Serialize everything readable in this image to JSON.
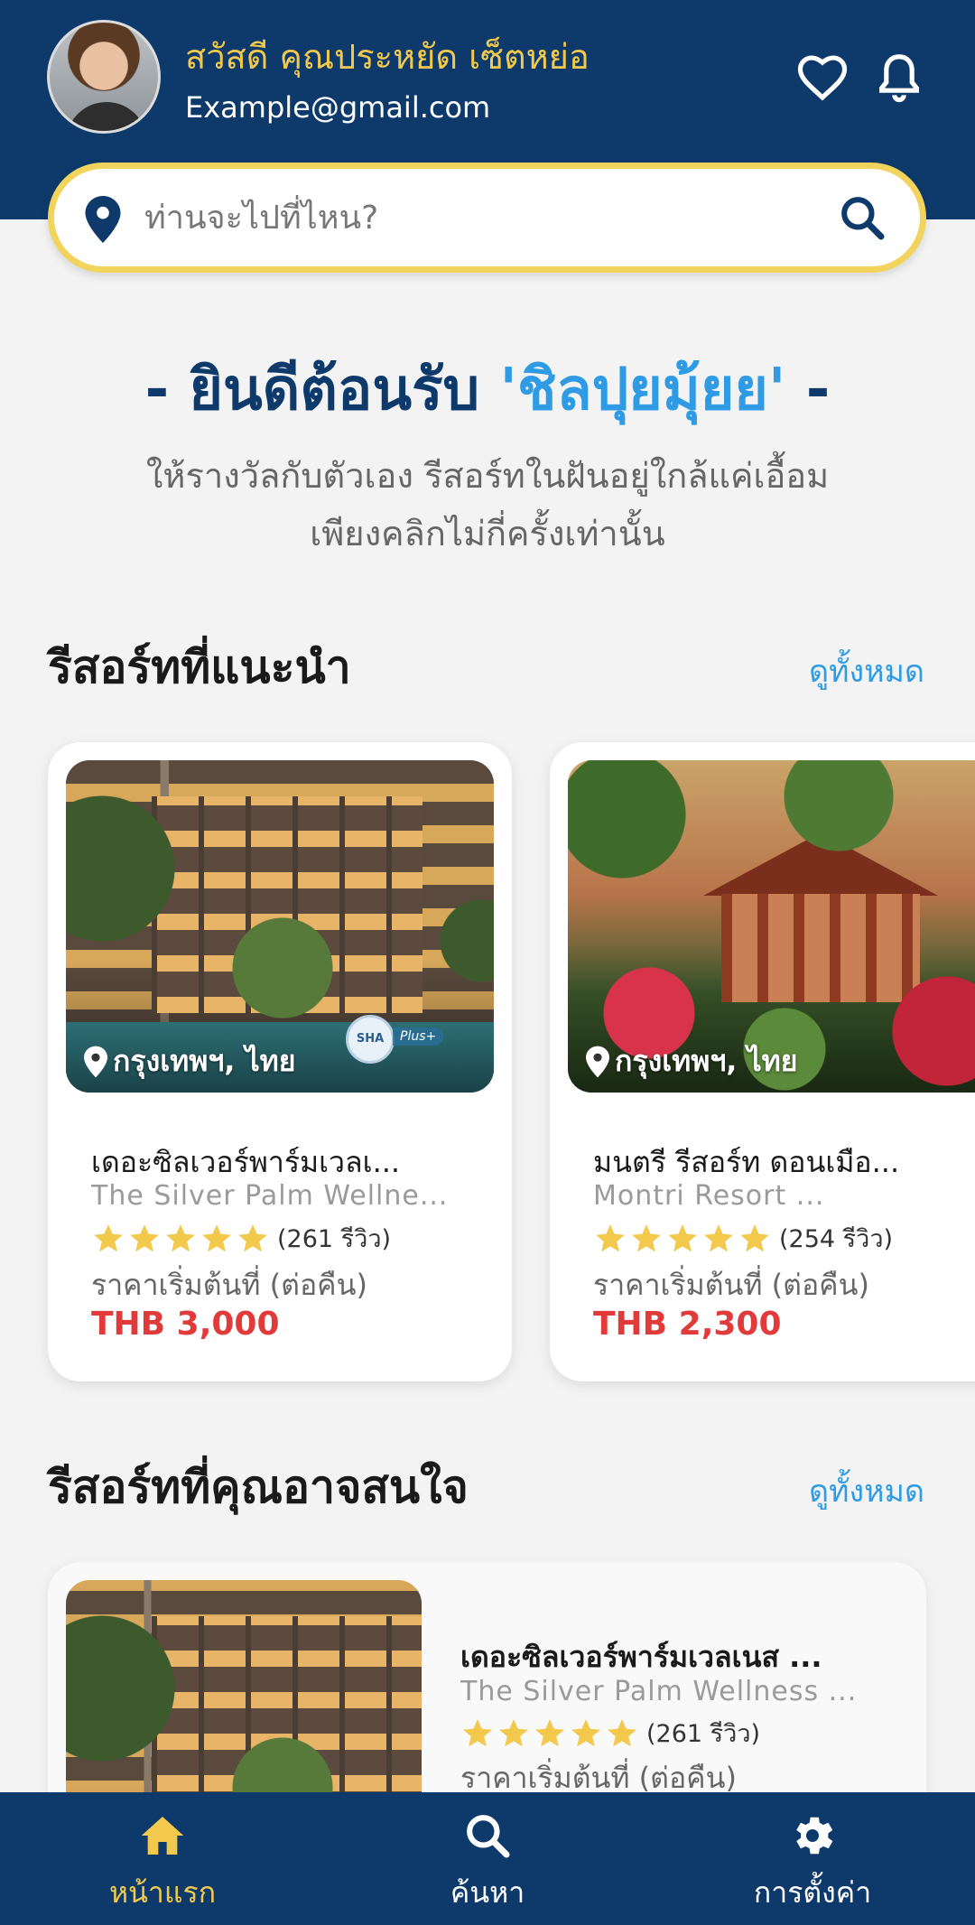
{
  "header": {
    "greeting": "สวัสดี คุณประหยัด เซ็ตหย่อ",
    "email": "Example@gmail.com",
    "icons": [
      "heart-icon",
      "bell-icon"
    ],
    "background_color": "#0e3a6b",
    "greeting_color": "#f2c94c"
  },
  "search": {
    "placeholder": "ท่านจะไปที่ไหน?",
    "value": "",
    "border_color": "#f2d45c"
  },
  "welcome": {
    "prefix": "- ยินดีต้อนรับ ",
    "brand": "'ชิลปุยมุ้ยย'",
    "suffix": " -",
    "subtitle_line1": "ให้รางวัลกับตัวเอง รีสอร์ทในฝันอยู่ใกล้แค่เอื้อม",
    "subtitle_line2": "เพียงคลิกไม่กี่ครั้งเท่านั้น"
  },
  "recommended": {
    "title": "รีสอร์ทที่แนะนำ",
    "see_all": "ดูทั้งหมด",
    "items": [
      {
        "location": "กรุงเทพฯ, ไทย",
        "name": "เดอะซิลเวอร์พาร์มเวลเ...",
        "name_en": "The Silver Palm Wellne...",
        "rating": 5,
        "reviews": "(261 รีวิว)",
        "price_label": "ราคาเริ่มต้นที่ (ต่อคืน)",
        "price": "THB 3,000",
        "badge": "SHA",
        "badge_plus": "Plus+"
      },
      {
        "location": "กรุงเทพฯ, ไทย",
        "name": "มนตรี รีสอร์ท ดอนเมือ...",
        "name_en": "Montri Resort ...",
        "rating": 5,
        "reviews": "(254 รีวิว)",
        "price_label": "ราคาเริ่มต้นที่ (ต่อคืน)",
        "price": "THB 2,300"
      }
    ]
  },
  "interested": {
    "title": "รีสอร์ทที่คุณอาจสนใจ",
    "see_all": "ดูทั้งหมด",
    "items": [
      {
        "name": "เดอะซิลเวอร์พาร์มเวลเนส ...",
        "name_en": "The Silver Palm Wellness ...",
        "rating": 5,
        "reviews": "(261 รีวิว)",
        "price_label": "ราคาเริ่มต้นที่ (ต่อคืน)"
      }
    ]
  },
  "bottom_nav": {
    "items": [
      {
        "label": "หน้าแรก",
        "icon": "home-icon",
        "active": true
      },
      {
        "label": "ค้นหา",
        "icon": "search-icon",
        "active": false
      },
      {
        "label": "การตั้งค่า",
        "icon": "gear-icon",
        "active": false
      }
    ],
    "active_color": "#f2c94c"
  },
  "colors": {
    "star": "#f2c94c",
    "price": "#e03a3a",
    "link": "#2f9be4"
  }
}
